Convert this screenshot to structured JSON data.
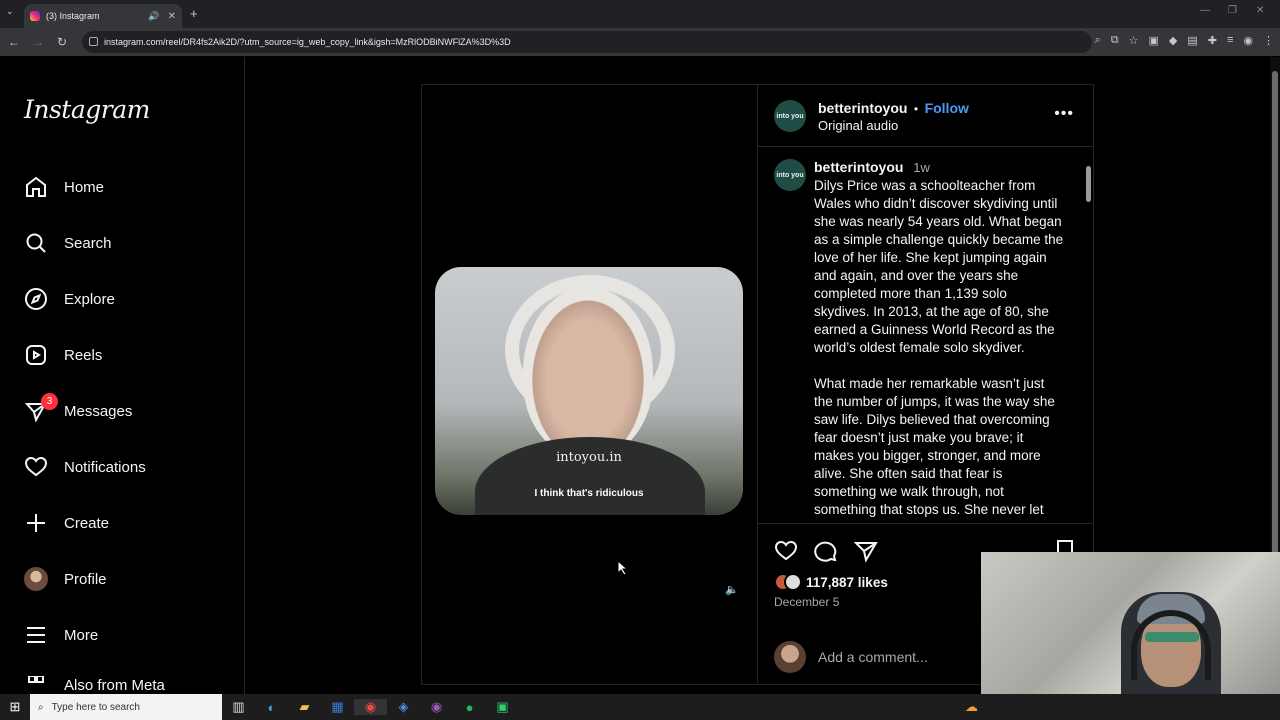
{
  "browser": {
    "tab_title": "(3) Instagram",
    "url": "instagram.com/reel/DR4fs2Aik2D/?utm_source=ig_web_copy_link&igsh=MzRlODBiNWFlZA%3D%3D"
  },
  "sidebar": {
    "logo": "Instagram",
    "items": [
      {
        "label": "Home",
        "icon": "home-icon"
      },
      {
        "label": "Search",
        "icon": "search-icon"
      },
      {
        "label": "Explore",
        "icon": "compass-icon"
      },
      {
        "label": "Reels",
        "icon": "reels-icon"
      },
      {
        "label": "Messages",
        "icon": "messenger-icon",
        "badge": "3"
      },
      {
        "label": "Notifications",
        "icon": "heart-icon"
      },
      {
        "label": "Create",
        "icon": "plus-icon"
      },
      {
        "label": "Profile",
        "icon": "profile-avatar"
      },
      {
        "label": "More",
        "icon": "menu-icon"
      },
      {
        "label": "Also from Meta",
        "icon": "meta-icon"
      }
    ]
  },
  "reel": {
    "watermark": "intoyou.in",
    "subtitle": "I think that's ridiculous"
  },
  "post": {
    "username": "betterintoyou",
    "separator": "•",
    "follow_label": "Follow",
    "audio": "Original audio",
    "avatar_text": "into you",
    "caption_time": "1w",
    "caption_paragraphs": [
      "Dilys Price was a schoolteacher from Wales who didn’t discover skydiving until she was nearly 54 years old. What began as a simple challenge quickly became the love of her life. She kept jumping again and again, and over the years she completed more than 1,139 solo skydives. In 2013, at the age of 80, she earned a Guinness World Record as the world’s oldest female solo skydiver.",
      "What made her remarkable wasn’t just the number of jumps, it was the way she saw life. Dilys believed that overcoming fear doesn’t just make you brave; it makes you bigger, stronger, and more alive. She often said that fear is something we walk through, not something that stops us. She never let"
    ],
    "likes": "117,887 likes",
    "date": "December 5",
    "comment_placeholder": "Add a comment..."
  },
  "taskbar": {
    "search_placeholder": "Type here to search"
  },
  "colors": {
    "follow_blue": "#4a9af5",
    "badge_red": "#ff3040",
    "avatar_green": "#1f4d45"
  }
}
